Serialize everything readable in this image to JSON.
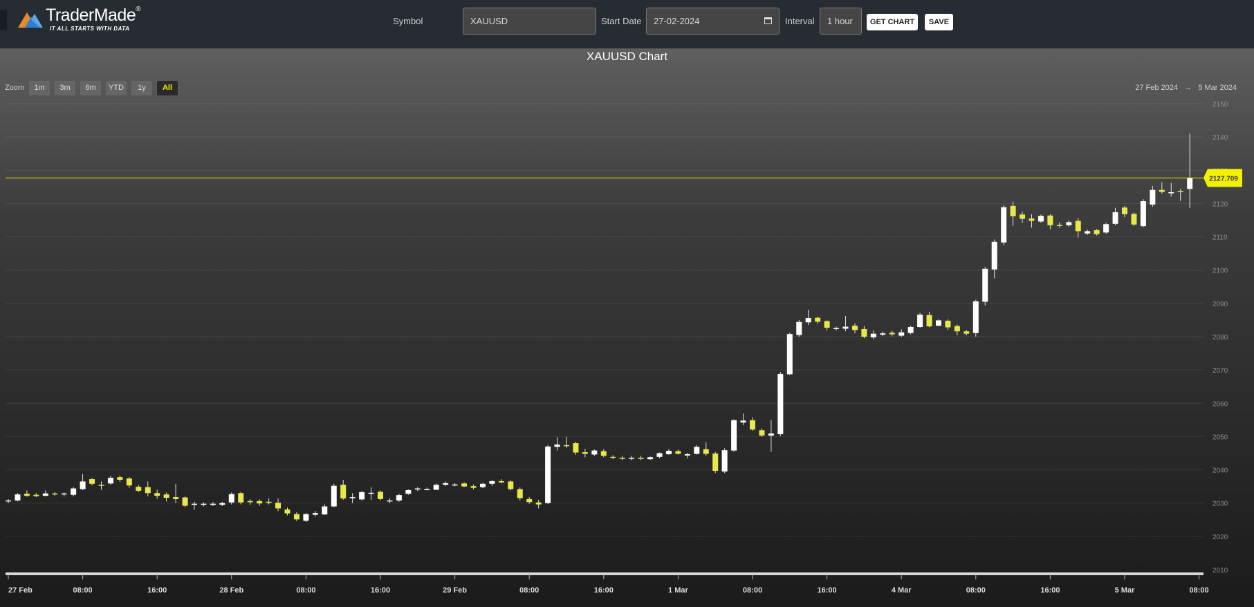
{
  "logo": {
    "name": "TraderMade",
    "reg": "®",
    "tagline": "IT ALL STARTS WITH DATA"
  },
  "form": {
    "symbol_label": "Symbol",
    "symbol_value": "XAUUSD",
    "start_date_label": "Start Date",
    "start_date_value": "27-02-2024",
    "interval_label": "Interval",
    "interval_value": "1 hour",
    "get_chart_label": "GET CHART",
    "save_label": "SAVE"
  },
  "zoom": {
    "label": "Zoom",
    "buttons": [
      "1m",
      "3m",
      "6m",
      "YTD",
      "1y",
      "All"
    ],
    "active": "All"
  },
  "range": {
    "from": "27 Feb 2024",
    "arrow": "→",
    "to": "5 Mar 2024"
  },
  "colors": {
    "up": "#ffffff",
    "down": "#e8e84a",
    "price_line": "#e8e800",
    "price_label_bg": "#f2f200"
  },
  "chart_data": {
    "type": "candlestick",
    "title": "XAUUSD Chart",
    "ylim": [
      2010,
      2150
    ],
    "yticks": [
      2010,
      2020,
      2030,
      2040,
      2050,
      2060,
      2070,
      2080,
      2090,
      2100,
      2110,
      2120,
      2130,
      2140,
      2150
    ],
    "xticks": [
      {
        "label": "27 Feb",
        "hour": 0
      },
      {
        "label": "08:00",
        "hour": 8
      },
      {
        "label": "16:00",
        "hour": 16
      },
      {
        "label": "28 Feb",
        "hour": 24
      },
      {
        "label": "08:00",
        "hour": 32
      },
      {
        "label": "16:00",
        "hour": 40
      },
      {
        "label": "29 Feb",
        "hour": 48
      },
      {
        "label": "08:00",
        "hour": 56
      },
      {
        "label": "16:00",
        "hour": 64
      },
      {
        "label": "1 Mar",
        "hour": 72
      },
      {
        "label": "08:00",
        "hour": 80
      },
      {
        "label": "16:00",
        "hour": 88
      },
      {
        "label": "4 Mar",
        "hour": 96
      },
      {
        "label": "08:00",
        "hour": 104
      },
      {
        "label": "16:00",
        "hour": 112
      },
      {
        "label": "5 Mar",
        "hour": 120
      },
      {
        "label": "08:00",
        "hour": 128
      }
    ],
    "last_price": "2127.709",
    "last_value": 2127.709,
    "ohlc": [
      [
        2030.5,
        2031.2,
        2030.0,
        2030.8
      ],
      [
        2030.8,
        2033.0,
        2030.5,
        2032.6
      ],
      [
        2032.8,
        2033.8,
        2031.9,
        2032.2
      ],
      [
        2032.5,
        2033.0,
        2031.8,
        2032.1
      ],
      [
        2032.2,
        2033.8,
        2032.0,
        2032.9
      ],
      [
        2032.9,
        2033.3,
        2032.2,
        2032.6
      ],
      [
        2032.6,
        2033.2,
        2032.0,
        2032.9
      ],
      [
        2032.5,
        2034.8,
        2032.0,
        2034.4
      ],
      [
        2034.2,
        2038.7,
        2033.9,
        2036.5
      ],
      [
        2037.2,
        2037.5,
        2035.3,
        2035.8
      ],
      [
        2035.5,
        2036.5,
        2034.0,
        2035.2
      ],
      [
        2035.9,
        2038.2,
        2035.5,
        2037.6
      ],
      [
        2037.8,
        2038.3,
        2036.4,
        2037.0
      ],
      [
        2037.4,
        2037.8,
        2034.6,
        2035.3
      ],
      [
        2034.9,
        2035.5,
        2033.3,
        2033.7
      ],
      [
        2034.8,
        2036.5,
        2032.0,
        2033.0
      ],
      [
        2033.0,
        2034.0,
        2031.3,
        2032.2
      ],
      [
        2032.6,
        2033.2,
        2030.5,
        2031.6
      ],
      [
        2031.8,
        2035.8,
        2030.0,
        2031.2
      ],
      [
        2031.7,
        2032.0,
        2028.8,
        2029.2
      ],
      [
        2029.5,
        2030.4,
        2028.0,
        2029.8
      ],
      [
        2029.6,
        2030.2,
        2029.0,
        2029.8
      ],
      [
        2029.6,
        2030.3,
        2029.1,
        2029.8
      ],
      [
        2029.5,
        2030.4,
        2029.1,
        2030.0
      ],
      [
        2030.2,
        2033.2,
        2029.6,
        2032.7
      ],
      [
        2033.0,
        2033.4,
        2029.6,
        2030.2
      ],
      [
        2030.6,
        2031.2,
        2029.5,
        2030.5
      ],
      [
        2030.6,
        2031.1,
        2029.2,
        2029.9
      ],
      [
        2030.4,
        2031.4,
        2029.6,
        2030.1
      ],
      [
        2030.1,
        2031.4,
        2027.6,
        2028.4
      ],
      [
        2028.1,
        2028.7,
        2026.3,
        2026.9
      ],
      [
        2026.7,
        2027.3,
        2024.6,
        2025.1
      ],
      [
        2024.7,
        2027.0,
        2024.3,
        2026.7
      ],
      [
        2026.5,
        2027.6,
        2025.9,
        2027.0
      ],
      [
        2026.6,
        2029.6,
        2026.4,
        2029.0
      ],
      [
        2029.0,
        2035.8,
        2028.8,
        2035.2
      ],
      [
        2035.5,
        2037.0,
        2031.0,
        2031.4
      ],
      [
        2031.5,
        2033.0,
        2030.0,
        2031.8
      ],
      [
        2031.1,
        2033.6,
        2030.8,
        2033.3
      ],
      [
        2032.9,
        2034.8,
        2031.0,
        2033.1
      ],
      [
        2033.4,
        2033.8,
        2030.8,
        2031.2
      ],
      [
        2030.8,
        2031.5,
        2030.0,
        2030.8
      ],
      [
        2030.8,
        2032.8,
        2030.4,
        2032.4
      ],
      [
        2032.8,
        2034.1,
        2032.5,
        2033.9
      ],
      [
        2034.1,
        2034.8,
        2033.6,
        2034.4
      ],
      [
        2034.2,
        2034.7,
        2033.8,
        2034.2
      ],
      [
        2034.0,
        2035.9,
        2033.9,
        2035.5
      ],
      [
        2035.5,
        2036.5,
        2035.2,
        2036.0
      ],
      [
        2035.6,
        2036.0,
        2035.0,
        2035.6
      ],
      [
        2035.9,
        2036.3,
        2034.8,
        2035.0
      ],
      [
        2035.1,
        2035.6,
        2034.1,
        2034.6
      ],
      [
        2034.8,
        2036.1,
        2034.5,
        2035.8
      ],
      [
        2035.8,
        2036.9,
        2035.2,
        2036.6
      ],
      [
        2036.6,
        2037.2,
        2036.0,
        2036.2
      ],
      [
        2036.5,
        2036.9,
        2033.8,
        2034.2
      ],
      [
        2034.2,
        2034.7,
        2030.8,
        2031.5
      ],
      [
        2031.2,
        2031.8,
        2029.8,
        2030.3
      ],
      [
        2030.2,
        2031.0,
        2028.4,
        2029.6
      ],
      [
        2030.0,
        2047.4,
        2029.8,
        2047.0
      ],
      [
        2046.9,
        2049.8,
        2045.8,
        2047.6
      ],
      [
        2047.4,
        2049.9,
        2046.6,
        2047.2
      ],
      [
        2048.0,
        2048.4,
        2044.5,
        2045.2
      ],
      [
        2045.3,
        2046.3,
        2043.8,
        2044.8
      ],
      [
        2044.6,
        2046.1,
        2044.2,
        2045.8
      ],
      [
        2045.6,
        2046.2,
        2043.8,
        2044.2
      ],
      [
        2043.9,
        2044.4,
        2043.2,
        2043.6
      ],
      [
        2043.6,
        2044.2,
        2042.9,
        2043.4
      ],
      [
        2043.3,
        2044.2,
        2042.8,
        2043.6
      ],
      [
        2043.6,
        2044.2,
        2042.9,
        2043.3
      ],
      [
        2043.2,
        2044.0,
        2042.9,
        2043.8
      ],
      [
        2043.9,
        2045.2,
        2043.5,
        2045.0
      ],
      [
        2044.7,
        2046.2,
        2044.5,
        2045.7
      ],
      [
        2045.6,
        2046.1,
        2044.6,
        2044.8
      ],
      [
        2044.3,
        2045.1,
        2043.4,
        2044.7
      ],
      [
        2044.8,
        2047.4,
        2044.6,
        2046.9
      ],
      [
        2046.2,
        2048.3,
        2044.2,
        2044.8
      ],
      [
        2044.9,
        2045.4,
        2039.0,
        2039.7
      ],
      [
        2039.5,
        2046.5,
        2039.0,
        2045.9
      ],
      [
        2045.8,
        2055.2,
        2045.4,
        2054.9
      ],
      [
        2054.2,
        2056.9,
        2053.4,
        2054.8
      ],
      [
        2054.9,
        2055.8,
        2051.7,
        2052.1
      ],
      [
        2051.9,
        2052.5,
        2049.9,
        2050.3
      ],
      [
        2050.3,
        2055.0,
        2045.4,
        2050.9
      ],
      [
        2050.7,
        2069.4,
        2050.1,
        2068.8
      ],
      [
        2068.7,
        2081.2,
        2068.5,
        2080.8
      ],
      [
        2080.5,
        2085.0,
        2080.0,
        2084.4
      ],
      [
        2084.3,
        2088.1,
        2083.5,
        2085.6
      ],
      [
        2085.7,
        2086.0,
        2083.8,
        2084.5
      ],
      [
        2084.7,
        2084.9,
        2081.9,
        2082.7
      ],
      [
        2082.6,
        2083.0,
        2081.8,
        2082.6
      ],
      [
        2082.4,
        2086.2,
        2081.6,
        2083.0
      ],
      [
        2083.3,
        2084.0,
        2081.0,
        2082.0
      ],
      [
        2082.3,
        2083.2,
        2079.5,
        2080.0
      ],
      [
        2079.8,
        2082.0,
        2079.2,
        2080.9
      ],
      [
        2080.6,
        2081.6,
        2080.2,
        2081.0
      ],
      [
        2081.2,
        2081.8,
        2080.1,
        2080.7
      ],
      [
        2080.3,
        2082.2,
        2079.9,
        2081.3
      ],
      [
        2081.1,
        2083.3,
        2080.7,
        2082.9
      ],
      [
        2082.9,
        2087.2,
        2082.7,
        2086.6
      ],
      [
        2086.5,
        2087.5,
        2082.8,
        2083.1
      ],
      [
        2083.3,
        2085.3,
        2083.1,
        2084.9
      ],
      [
        2084.8,
        2085.2,
        2082.0,
        2082.8
      ],
      [
        2083.2,
        2083.6,
        2080.4,
        2081.6
      ],
      [
        2081.6,
        2082.0,
        2080.4,
        2080.9
      ],
      [
        2081.1,
        2091.1,
        2080.0,
        2090.6
      ],
      [
        2090.5,
        2101.0,
        2089.4,
        2100.4
      ],
      [
        2100.2,
        2109.2,
        2097.5,
        2108.5
      ],
      [
        2108.3,
        2119.5,
        2107.5,
        2118.9
      ],
      [
        2119.3,
        2120.6,
        2113.3,
        2116.2
      ],
      [
        2116.7,
        2117.5,
        2114.2,
        2115.4
      ],
      [
        2115.5,
        2116.8,
        2112.8,
        2114.8
      ],
      [
        2114.6,
        2116.7,
        2114.2,
        2116.3
      ],
      [
        2116.4,
        2116.8,
        2112.3,
        2113.5
      ],
      [
        2113.6,
        2114.3,
        2112.7,
        2113.3
      ],
      [
        2113.5,
        2115.0,
        2113.0,
        2114.4
      ],
      [
        2114.8,
        2115.6,
        2109.8,
        2111.7
      ],
      [
        2111.0,
        2112.2,
        2110.6,
        2111.7
      ],
      [
        2112.0,
        2112.4,
        2110.4,
        2110.8
      ],
      [
        2111.3,
        2114.2,
        2110.9,
        2113.8
      ],
      [
        2113.9,
        2118.7,
        2113.5,
        2117.4
      ],
      [
        2118.8,
        2119.3,
        2115.9,
        2116.8
      ],
      [
        2116.9,
        2117.3,
        2113.2,
        2113.7
      ],
      [
        2113.2,
        2121.3,
        2112.9,
        2120.7
      ],
      [
        2119.7,
        2125.3,
        2119.0,
        2124.1
      ],
      [
        2124.1,
        2126.4,
        2123.0,
        2123.5
      ],
      [
        2123.2,
        2126.2,
        2122.1,
        2123.4
      ],
      [
        2123.8,
        2124.4,
        2120.8,
        2123.7
      ],
      [
        2124.4,
        2141.0,
        2118.6,
        2127.7
      ]
    ]
  }
}
